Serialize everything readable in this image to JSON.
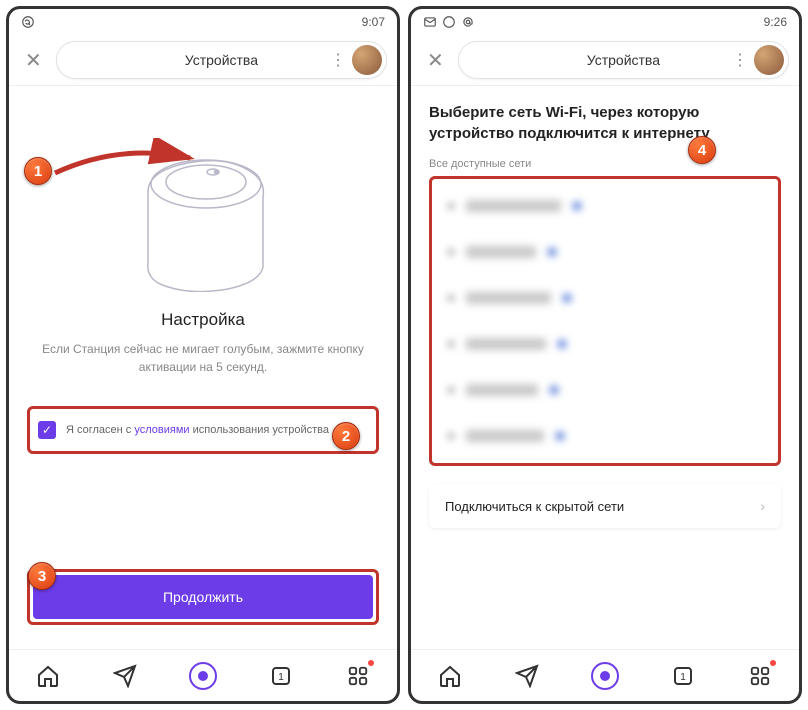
{
  "left": {
    "status_time": "9:07",
    "header_title": "Устройства",
    "setup_title": "Настройка",
    "setup_desc": "Если Станция сейчас не мигает голубым, зажмите кнопку активации на 5 секунд.",
    "consent_prefix": "Я согласен с ",
    "consent_link": "условиями",
    "consent_suffix": " использования устройства",
    "continue_label": "Продолжить"
  },
  "right": {
    "status_time": "9:26",
    "header_title": "Устройства",
    "wifi_heading": "Выберите сеть Wi-Fi, через которую устройство подключится к интернету",
    "wifi_subheading": "Все доступные сети",
    "hidden_network_label": "Подключиться к скрытой сети"
  },
  "markers": {
    "m1": "1",
    "m2": "2",
    "m3": "3",
    "m4": "4"
  },
  "nav": {
    "home": "home",
    "send": "send",
    "alice": "alice",
    "tabs": "1",
    "apps": "apps"
  }
}
